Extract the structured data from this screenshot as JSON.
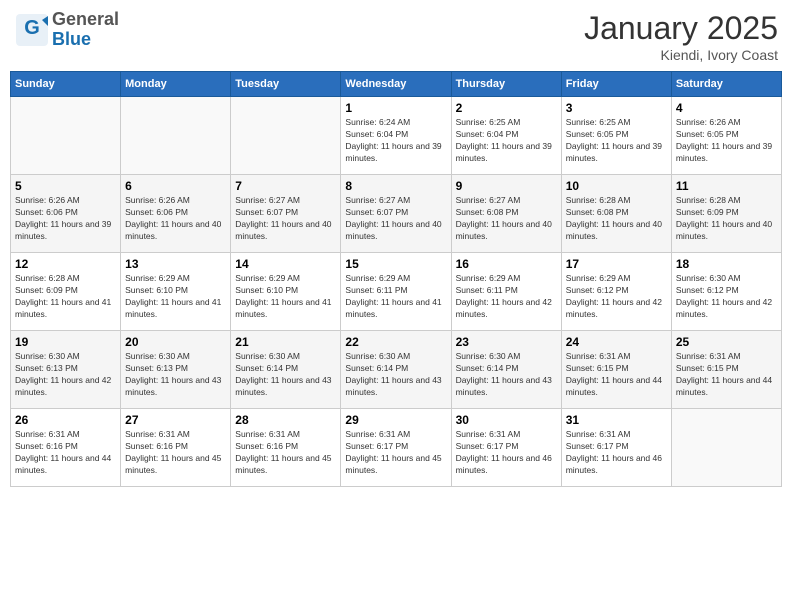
{
  "header": {
    "logo_line1": "General",
    "logo_line2": "Blue",
    "title": "January 2025",
    "location": "Kiendi, Ivory Coast"
  },
  "days_of_week": [
    "Sunday",
    "Monday",
    "Tuesday",
    "Wednesday",
    "Thursday",
    "Friday",
    "Saturday"
  ],
  "weeks": [
    [
      {
        "day": "",
        "info": ""
      },
      {
        "day": "",
        "info": ""
      },
      {
        "day": "",
        "info": ""
      },
      {
        "day": "1",
        "info": "Sunrise: 6:24 AM\nSunset: 6:04 PM\nDaylight: 11 hours and 39 minutes."
      },
      {
        "day": "2",
        "info": "Sunrise: 6:25 AM\nSunset: 6:04 PM\nDaylight: 11 hours and 39 minutes."
      },
      {
        "day": "3",
        "info": "Sunrise: 6:25 AM\nSunset: 6:05 PM\nDaylight: 11 hours and 39 minutes."
      },
      {
        "day": "4",
        "info": "Sunrise: 6:26 AM\nSunset: 6:05 PM\nDaylight: 11 hours and 39 minutes."
      }
    ],
    [
      {
        "day": "5",
        "info": "Sunrise: 6:26 AM\nSunset: 6:06 PM\nDaylight: 11 hours and 39 minutes."
      },
      {
        "day": "6",
        "info": "Sunrise: 6:26 AM\nSunset: 6:06 PM\nDaylight: 11 hours and 40 minutes."
      },
      {
        "day": "7",
        "info": "Sunrise: 6:27 AM\nSunset: 6:07 PM\nDaylight: 11 hours and 40 minutes."
      },
      {
        "day": "8",
        "info": "Sunrise: 6:27 AM\nSunset: 6:07 PM\nDaylight: 11 hours and 40 minutes."
      },
      {
        "day": "9",
        "info": "Sunrise: 6:27 AM\nSunset: 6:08 PM\nDaylight: 11 hours and 40 minutes."
      },
      {
        "day": "10",
        "info": "Sunrise: 6:28 AM\nSunset: 6:08 PM\nDaylight: 11 hours and 40 minutes."
      },
      {
        "day": "11",
        "info": "Sunrise: 6:28 AM\nSunset: 6:09 PM\nDaylight: 11 hours and 40 minutes."
      }
    ],
    [
      {
        "day": "12",
        "info": "Sunrise: 6:28 AM\nSunset: 6:09 PM\nDaylight: 11 hours and 41 minutes."
      },
      {
        "day": "13",
        "info": "Sunrise: 6:29 AM\nSunset: 6:10 PM\nDaylight: 11 hours and 41 minutes."
      },
      {
        "day": "14",
        "info": "Sunrise: 6:29 AM\nSunset: 6:10 PM\nDaylight: 11 hours and 41 minutes."
      },
      {
        "day": "15",
        "info": "Sunrise: 6:29 AM\nSunset: 6:11 PM\nDaylight: 11 hours and 41 minutes."
      },
      {
        "day": "16",
        "info": "Sunrise: 6:29 AM\nSunset: 6:11 PM\nDaylight: 11 hours and 42 minutes."
      },
      {
        "day": "17",
        "info": "Sunrise: 6:29 AM\nSunset: 6:12 PM\nDaylight: 11 hours and 42 minutes."
      },
      {
        "day": "18",
        "info": "Sunrise: 6:30 AM\nSunset: 6:12 PM\nDaylight: 11 hours and 42 minutes."
      }
    ],
    [
      {
        "day": "19",
        "info": "Sunrise: 6:30 AM\nSunset: 6:13 PM\nDaylight: 11 hours and 42 minutes."
      },
      {
        "day": "20",
        "info": "Sunrise: 6:30 AM\nSunset: 6:13 PM\nDaylight: 11 hours and 43 minutes."
      },
      {
        "day": "21",
        "info": "Sunrise: 6:30 AM\nSunset: 6:14 PM\nDaylight: 11 hours and 43 minutes."
      },
      {
        "day": "22",
        "info": "Sunrise: 6:30 AM\nSunset: 6:14 PM\nDaylight: 11 hours and 43 minutes."
      },
      {
        "day": "23",
        "info": "Sunrise: 6:30 AM\nSunset: 6:14 PM\nDaylight: 11 hours and 43 minutes."
      },
      {
        "day": "24",
        "info": "Sunrise: 6:31 AM\nSunset: 6:15 PM\nDaylight: 11 hours and 44 minutes."
      },
      {
        "day": "25",
        "info": "Sunrise: 6:31 AM\nSunset: 6:15 PM\nDaylight: 11 hours and 44 minutes."
      }
    ],
    [
      {
        "day": "26",
        "info": "Sunrise: 6:31 AM\nSunset: 6:16 PM\nDaylight: 11 hours and 44 minutes."
      },
      {
        "day": "27",
        "info": "Sunrise: 6:31 AM\nSunset: 6:16 PM\nDaylight: 11 hours and 45 minutes."
      },
      {
        "day": "28",
        "info": "Sunrise: 6:31 AM\nSunset: 6:16 PM\nDaylight: 11 hours and 45 minutes."
      },
      {
        "day": "29",
        "info": "Sunrise: 6:31 AM\nSunset: 6:17 PM\nDaylight: 11 hours and 45 minutes."
      },
      {
        "day": "30",
        "info": "Sunrise: 6:31 AM\nSunset: 6:17 PM\nDaylight: 11 hours and 46 minutes."
      },
      {
        "day": "31",
        "info": "Sunrise: 6:31 AM\nSunset: 6:17 PM\nDaylight: 11 hours and 46 minutes."
      },
      {
        "day": "",
        "info": ""
      }
    ]
  ]
}
